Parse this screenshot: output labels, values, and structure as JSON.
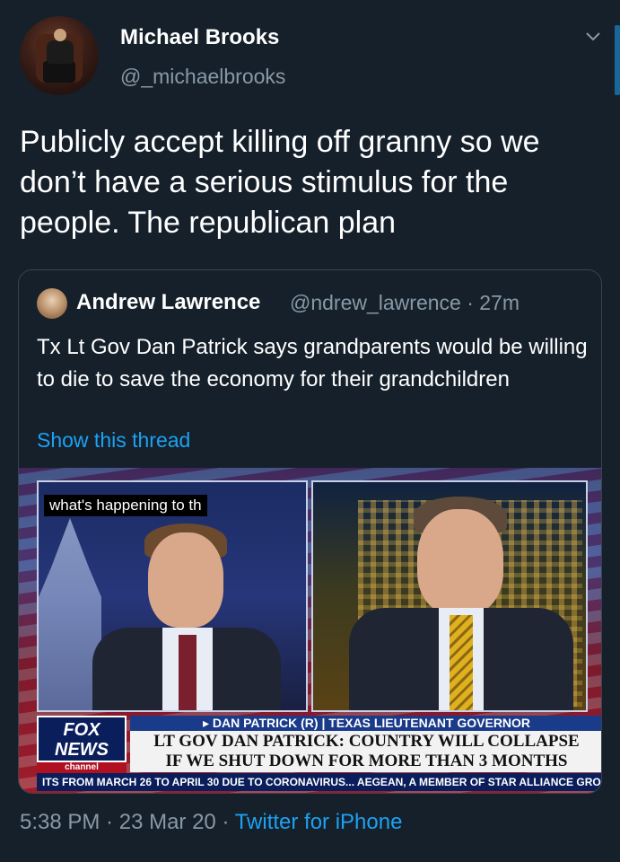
{
  "author": {
    "display_name": "Michael Brooks",
    "handle": "@_michaelbrooks"
  },
  "tweet": {
    "text": "Publicly accept killing off granny so we don’t have a serious stimulus for the people. The republican plan"
  },
  "quoted_tweet": {
    "display_name": "Andrew Lawrence",
    "handle_time": "@ndrew_lawrence · 27m",
    "text": "Tx Lt Gov Dan Patrick says grandparents would be willing to die to save the economy for their grandchildren",
    "thread_link": "Show this thread",
    "video": {
      "caption": "what's happening to th",
      "network_logo": "FOX NEWS",
      "network_sub": "channel",
      "topline": "▸ DAN PATRICK (R) | TEXAS LIEUTENANT GOVERNOR",
      "headline_line1": "LT GOV DAN PATRICK: COUNTRY WILL COLLAPSE",
      "headline_line2": "IF WE SHUT DOWN FOR MORE THAN 3 MONTHS",
      "ticker": "ITS FROM MARCH 26 TO APRIL 30 DUE TO CORONAVIRUS... AEGEAN, A MEMBER OF STAR ALLIANCE GRO"
    }
  },
  "footer": {
    "time": "5:38 PM",
    "date": "23 Mar 20",
    "separator": " · ",
    "source": "Twitter for iPhone"
  },
  "colors": {
    "background": "#15202b",
    "accent": "#1da1f2",
    "secondary_text": "#8899a6"
  }
}
